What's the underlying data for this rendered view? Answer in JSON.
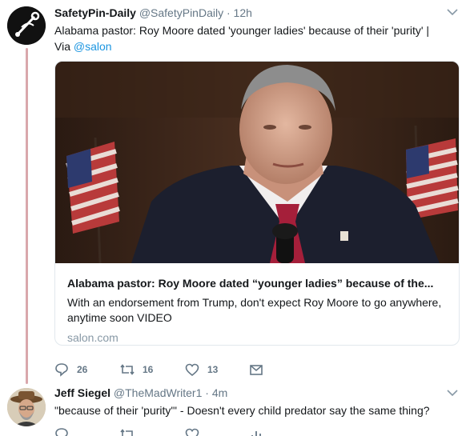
{
  "tweets": [
    {
      "name": "SafetyPin-Daily",
      "handle": "@SafetyPinDaily",
      "dot": "·",
      "time": "12h",
      "text_main": "Alabama pastor: Roy Moore dated 'younger ladies' because of their 'purity'   |",
      "text_via": "Via ",
      "text_link": "@salon",
      "card": {
        "title": "Alabama pastor: Roy Moore dated “younger ladies” because of the...",
        "description": "With an endorsement from Trump, don't expect Roy Moore to go anywhere, anytime soon VIDEO",
        "domain": "salon.com"
      },
      "stats": {
        "replies": "26",
        "retweets": "16",
        "likes": "13"
      }
    },
    {
      "name": "Jeff Siegel",
      "handle": "@TheMadWriter1",
      "dot": "·",
      "time": "4m",
      "text_main": "\"because of their 'purity'\" - Doesn't every child predator say the same thing?"
    }
  ],
  "colors": {
    "link": "#1b95e0",
    "thread_line": "#d9a7ac",
    "muted": "#657786"
  },
  "icons": [
    "pin-logo-icon",
    "chevron-down-icon",
    "reply-icon",
    "retweet-icon",
    "heart-icon",
    "envelope-icon",
    "analytics-icon"
  ]
}
